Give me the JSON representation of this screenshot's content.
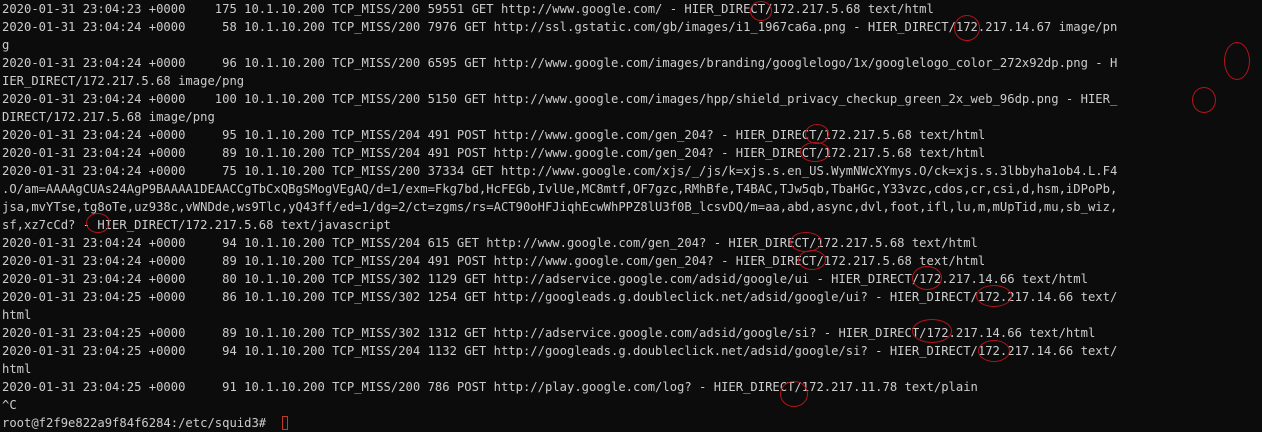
{
  "terminal": {
    "lines": [
      "2020-01-31 23:04:23 +0000    175 10.1.10.200 TCP_MISS/200 59551 GET http://www.google.com/ - HIER_DIRECT/172.217.5.68 text/html",
      "2020-01-31 23:04:24 +0000     58 10.1.10.200 TCP_MISS/200 7976 GET http://ssl.gstatic.com/gb/images/i1_1967ca6a.png - HIER_DIRECT/172.217.14.67 image/pn",
      "g",
      "2020-01-31 23:04:24 +0000     96 10.1.10.200 TCP_MISS/200 6595 GET http://www.google.com/images/branding/googlelogo/1x/googlelogo_color_272x92dp.png - H",
      "IER_DIRECT/172.217.5.68 image/png",
      "2020-01-31 23:04:24 +0000    100 10.1.10.200 TCP_MISS/200 5150 GET http://www.google.com/images/hpp/shield_privacy_checkup_green_2x_web_96dp.png - HIER_",
      "DIRECT/172.217.5.68 image/png",
      "2020-01-31 23:04:24 +0000     95 10.1.10.200 TCP_MISS/204 491 POST http://www.google.com/gen_204? - HIER_DIRECT/172.217.5.68 text/html",
      "2020-01-31 23:04:24 +0000     89 10.1.10.200 TCP_MISS/204 491 POST http://www.google.com/gen_204? - HIER_DIRECT/172.217.5.68 text/html",
      "2020-01-31 23:04:24 +0000     75 10.1.10.200 TCP_MISS/200 37334 GET http://www.google.com/xjs/_/js/k=xjs.s.en_US.WymNWcXYmys.O/ck=xjs.s.3lbbyha1ob4.L.F4",
      ".O/am=AAAAgCUAs24AgP9BAAAA1DEAACCgTbCxQBgSMogVEgAQ/d=1/exm=Fkg7bd,HcFEGb,IvlUe,MC8mtf,OF7gzc,RMhBfe,T4BAC,TJw5qb,TbaHGc,Y33vzc,cdos,cr,csi,d,hsm,iDPoPb,",
      "jsa,mvYTse,tg8oTe,uz938c,vWNDde,ws9Tlc,yQ43ff/ed=1/dg=2/ct=zgms/rs=ACT90oHFJiqhEcwWhPPZ8lU3f0B_lcsvDQ/m=aa,abd,async,dvl,foot,ifl,lu,m,mUpTid,mu,sb_wiz,",
      "sf,xz7cCd? - HIER_DIRECT/172.217.5.68 text/javascript",
      "2020-01-31 23:04:24 +0000     94 10.1.10.200 TCP_MISS/204 615 GET http://www.google.com/gen_204? - HIER_DIRECT/172.217.5.68 text/html",
      "2020-01-31 23:04:24 +0000     89 10.1.10.200 TCP_MISS/204 491 POST http://www.google.com/gen_204? - HIER_DIRECT/172.217.5.68 text/html",
      "2020-01-31 23:04:24 +0000     80 10.1.10.200 TCP_MISS/302 1129 GET http://adservice.google.com/adsid/google/ui - HIER_DIRECT/172.217.14.66 text/html",
      "2020-01-31 23:04:25 +0000     86 10.1.10.200 TCP_MISS/302 1254 GET http://googleads.g.doubleclick.net/adsid/google/ui? - HIER_DIRECT/172.217.14.66 text/",
      "html",
      "2020-01-31 23:04:25 +0000     89 10.1.10.200 TCP_MISS/302 1312 GET http://adservice.google.com/adsid/google/si? - HIER_DIRECT/172.217.14.66 text/html",
      "2020-01-31 23:04:25 +0000     94 10.1.10.200 TCP_MISS/204 1132 GET http://googleads.g.doubleclick.net/adsid/google/si? - HIER_DIRECT/172.217.14.66 text/",
      "html",
      "2020-01-31 23:04:25 +0000     91 10.1.10.200 TCP_MISS/200 786 POST http://play.google.com/log? - HIER_DIRECT/172.217.11.78 text/plain",
      "^C"
    ],
    "prompt": "root@f2f9e822a9f84f6284:/etc/squid3# ",
    "annotation_color": "#b3141a",
    "text_color": "#cccccc",
    "background_color": "#0c0c0c"
  }
}
